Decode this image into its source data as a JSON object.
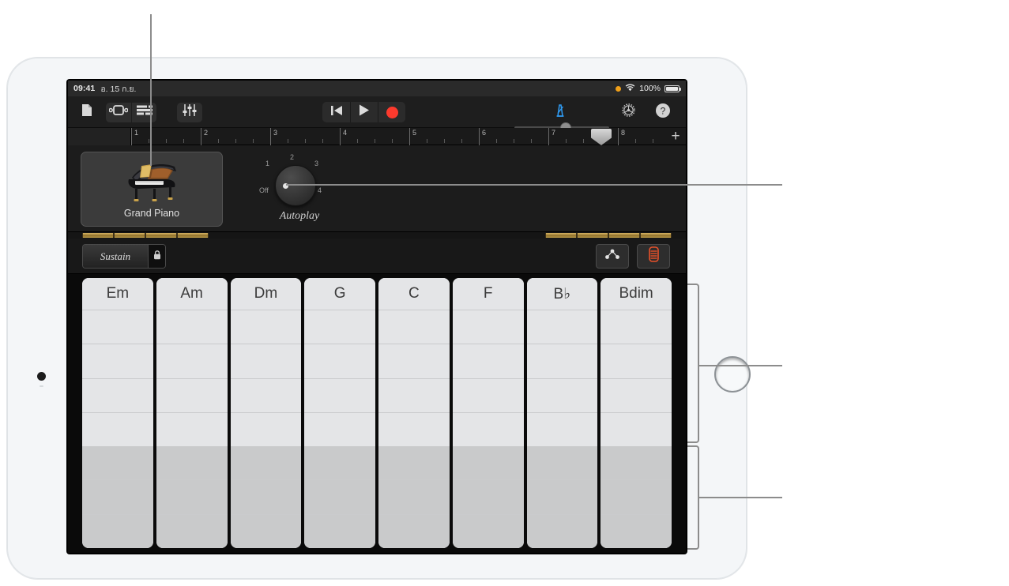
{
  "device": {
    "name": "ipad",
    "home_button": "home-button",
    "camera": "front-camera"
  },
  "statusbar": {
    "time": "09:41",
    "date": "อ. 15 ก.ย.",
    "battery_percent": "100%",
    "icons": [
      "orange-recording-dot",
      "wifi-icon",
      "battery-icon"
    ]
  },
  "toolbar": {
    "left_icons": [
      "document-icon",
      "track-view-icon",
      "tracks-list-icon",
      "mixer-faders-icon"
    ],
    "transport": [
      "rewind-icon",
      "play-icon",
      "record-icon"
    ],
    "volume_label": "master-volume-slider",
    "metronome": "metronome-icon",
    "right_icons": [
      "settings-gear-icon",
      "help-question-icon"
    ]
  },
  "ruler": {
    "bars": [
      "1",
      "2",
      "3",
      "4",
      "5",
      "6",
      "7",
      "8"
    ],
    "playhead_label": "playhead-marker",
    "add_label": "+"
  },
  "instrument": {
    "name": "Grand Piano",
    "image": "grand-piano-image"
  },
  "autoplay": {
    "title": "Autoplay",
    "off_label": "Off",
    "positions": [
      "1",
      "2",
      "3",
      "4"
    ],
    "current": "Off"
  },
  "controls": {
    "sustain_label": "Sustain",
    "lock_icon": "lock-icon",
    "chords_button": "chords-notes-icon",
    "keyboard_button": "keyboard-strip-icon",
    "keyboard_accent": "#e8512a"
  },
  "chords": {
    "strips": [
      {
        "label": "Em"
      },
      {
        "label": "Am"
      },
      {
        "label": "Dm"
      },
      {
        "label": "G"
      },
      {
        "label": "C"
      },
      {
        "label": "F"
      },
      {
        "label": "B♭"
      },
      {
        "label": "Bdim"
      }
    ],
    "light_rows": 4,
    "dark_rows": 3
  },
  "callouts": {
    "top_pointer": "callout-to-instrument",
    "autoplay_pointer": "callout-to-autoplay-knob",
    "bracket_upper": "callout-bracket-chord-upper",
    "bracket_lower": "callout-bracket-chord-lower"
  }
}
